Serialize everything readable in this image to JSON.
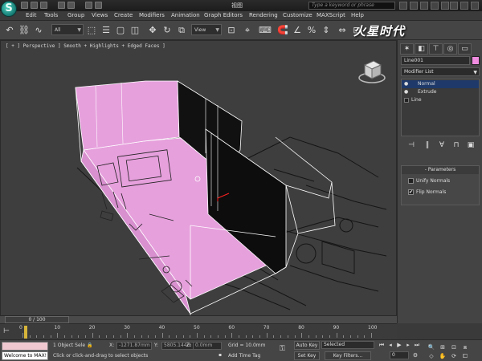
{
  "window": {
    "title": "视图",
    "search_placeholder": "Type a keyword or phrase",
    "app_logo": "3ds Max logo"
  },
  "menu": {
    "items": [
      "Edit",
      "Tools",
      "Group",
      "Views",
      "Create",
      "Modifiers",
      "Animation",
      "Graph Editors",
      "Rendering",
      "Customize",
      "MAXScript",
      "Help"
    ]
  },
  "toolbar": {
    "selection_filter": "All",
    "reference_coord": "View",
    "icons": [
      "undo-icon",
      "redo-icon",
      "link-icon",
      "unlink-icon",
      "bind-icon",
      "select-icon",
      "select-by-name-icon",
      "rect-region-icon",
      "window-crossing-icon",
      "move-icon",
      "rotate-icon",
      "scale-icon",
      "pivot-icon",
      "snap-icon",
      "angle-snap-icon",
      "percent-snap-icon",
      "mirror-icon",
      "align-icon",
      "layers-icon",
      "curve-editor-icon",
      "material-editor-icon",
      "render-setup-icon",
      "render-icon"
    ]
  },
  "brand_watermark": "火星时代",
  "viewport": {
    "label": "[ + ] Perspective ] Smooth + Highlights + Edged Faces ]",
    "colors": {
      "selected_faces": "#e6a0dc",
      "wire": "#ffffff",
      "bg": "#3e3e3e"
    }
  },
  "command_panel": {
    "object_name": "Line001",
    "object_color": "#f08ce0",
    "modifier_list_label": "Modifier List",
    "stack": [
      {
        "label": "Normal",
        "selected": true
      },
      {
        "label": "Extrude",
        "selected": false
      },
      {
        "label": "Line",
        "selected": false
      }
    ],
    "parameters": {
      "header": "Parameters",
      "unify_normals": {
        "label": "Unify Normals",
        "checked": false
      },
      "flip_normals": {
        "label": "Flip Normals",
        "checked": true
      }
    }
  },
  "timeline": {
    "frame_counter": "0 / 100",
    "ticks": [
      "0",
      "10",
      "20",
      "30",
      "40",
      "50",
      "60",
      "70",
      "80",
      "90",
      "100"
    ]
  },
  "status": {
    "maxscript_bottom": "Welcome to MAX!",
    "objects_selected": "1 Object Sele",
    "prompt": "Click or click-and-drag to select objects",
    "x_label": "X:",
    "x_value": "-1271.87mm",
    "y_label": "Y:",
    "y_value": "5805.144m",
    "z_label": "Z:",
    "z_value": "0.0mm",
    "grid": "Grid = 10.0mm",
    "add_time_tag": "Add Time Tag",
    "auto_key": "Auto Key",
    "auto_key_mode": "Selected",
    "set_key": "Set Key",
    "key_filters": "Key Filters...",
    "current_frame": "0"
  }
}
